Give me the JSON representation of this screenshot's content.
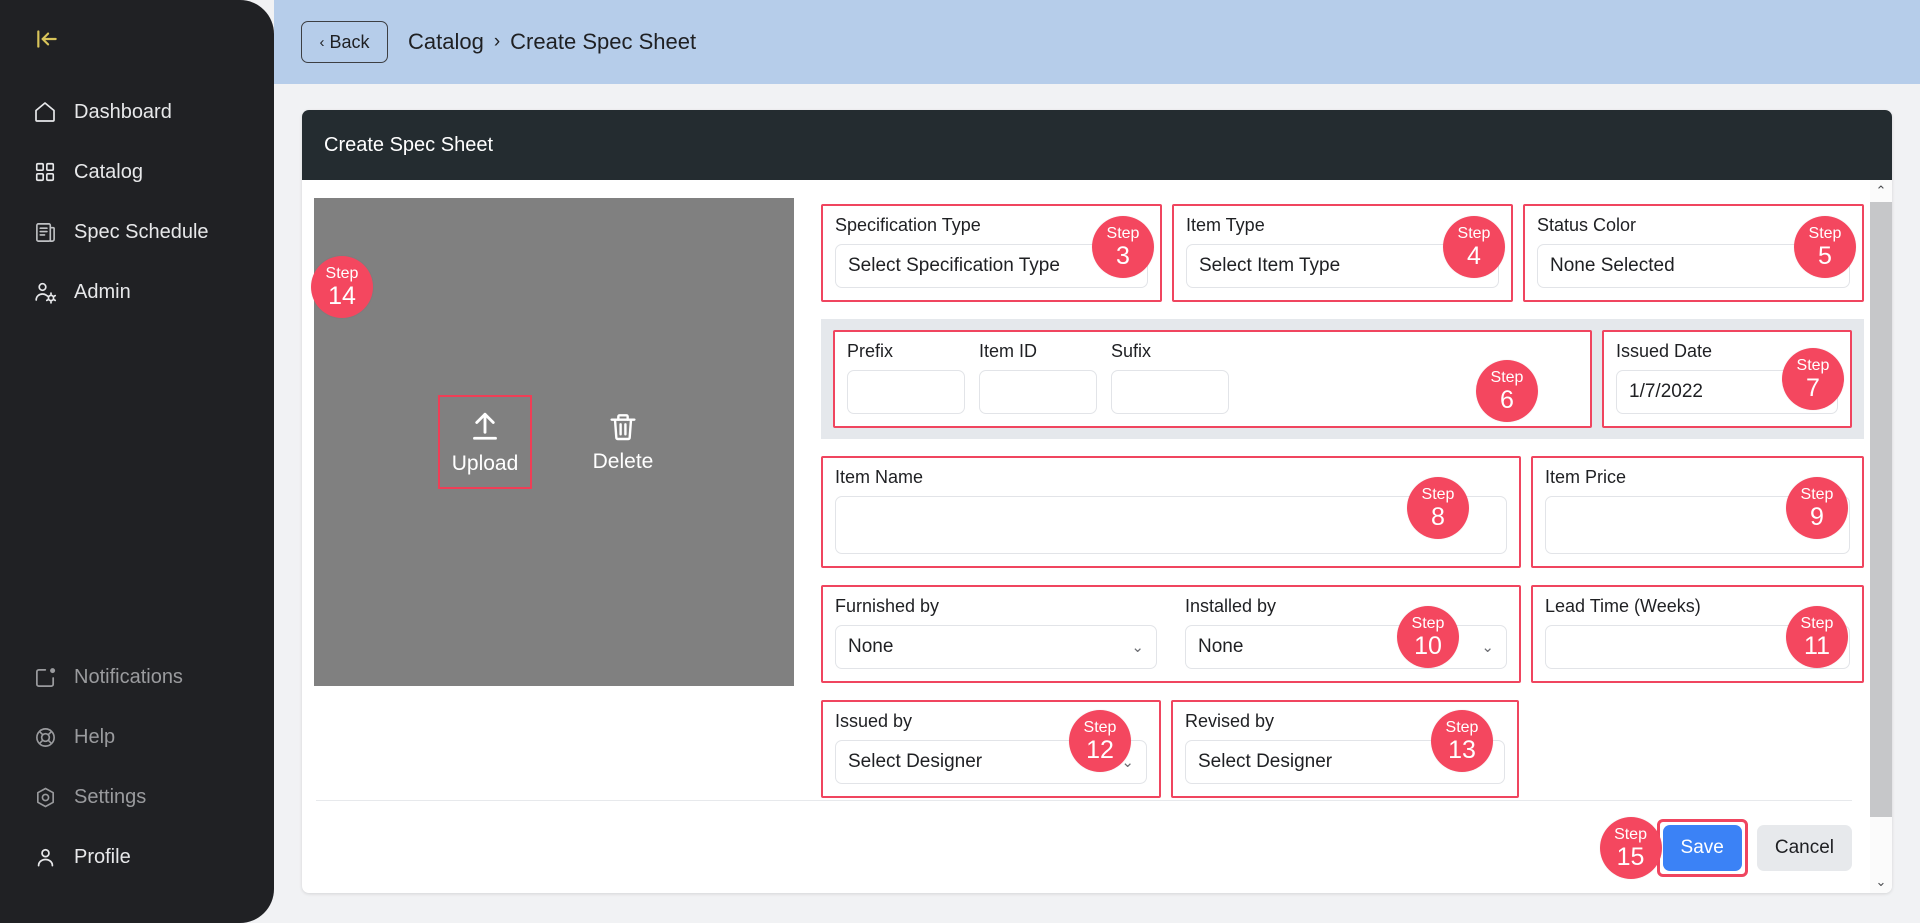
{
  "sidebar": {
    "collapse_icon": "collapse-panel-icon",
    "top_items": [
      {
        "label": "Dashboard",
        "icon": "home-icon"
      },
      {
        "label": "Catalog",
        "icon": "grid-icon"
      },
      {
        "label": "Spec Schedule",
        "icon": "document-list-icon"
      },
      {
        "label": "Admin",
        "icon": "user-gear-icon"
      }
    ],
    "bottom_items": [
      {
        "label": "Notifications",
        "icon": "notification-icon"
      },
      {
        "label": "Help",
        "icon": "lifebuoy-icon"
      },
      {
        "label": "Settings",
        "icon": "gear-icon"
      },
      {
        "label": "Profile",
        "icon": "user-icon"
      }
    ]
  },
  "topbar": {
    "back_label": "Back",
    "back_chevron": "‹",
    "crumb_root": "Catalog",
    "crumb_sep": "›",
    "crumb_current": "Create Spec Sheet"
  },
  "card": {
    "title": "Create Spec Sheet"
  },
  "image_panel": {
    "upload_label": "Upload",
    "upload_icon": "upload-arrow-icon",
    "delete_label": "Delete",
    "delete_icon": "trash-icon"
  },
  "form": {
    "specification_type": {
      "label": "Specification Type",
      "value": "Select Specification Type"
    },
    "item_type": {
      "label": "Item Type",
      "value": "Select Item Type"
    },
    "status_color": {
      "label": "Status Color",
      "value": "None Selected"
    },
    "prefix": {
      "label": "Prefix",
      "value": ""
    },
    "item_id": {
      "label": "Item ID",
      "value": ""
    },
    "sufix": {
      "label": "Sufix",
      "value": ""
    },
    "issued_date": {
      "label": "Issued Date",
      "value": "1/7/2022"
    },
    "item_name": {
      "label": "Item Name",
      "value": ""
    },
    "item_price": {
      "label": "Item Price",
      "value": ""
    },
    "furnished_by": {
      "label": "Furnished by",
      "value": "None"
    },
    "installed_by": {
      "label": "Installed by",
      "value": "None"
    },
    "lead_time": {
      "label": "Lead Time (Weeks)",
      "value": ""
    },
    "issued_by": {
      "label": "Issued by",
      "value": "Select Designer"
    },
    "revised_by": {
      "label": "Revised by",
      "value": "Select Designer"
    }
  },
  "footer": {
    "save_label": "Save",
    "cancel_label": "Cancel"
  },
  "steps": {
    "word": "Step",
    "s3": "3",
    "s4": "4",
    "s5": "5",
    "s6": "6",
    "s7": "7",
    "s8": "8",
    "s9": "9",
    "s10": "10",
    "s11": "11",
    "s12": "12",
    "s13": "13",
    "s14": "14",
    "s15": "15"
  },
  "scrollbar": {
    "up": "⌃",
    "down": "⌄"
  },
  "colors": {
    "accent_step": "#f4475f",
    "highlight_border": "#f0455f",
    "sidebar_bg": "#202124",
    "topbar_bg": "#b6cdea",
    "card_head_bg": "#242c30",
    "save_button": "#3b82f6",
    "image_placeholder": "#808080"
  }
}
